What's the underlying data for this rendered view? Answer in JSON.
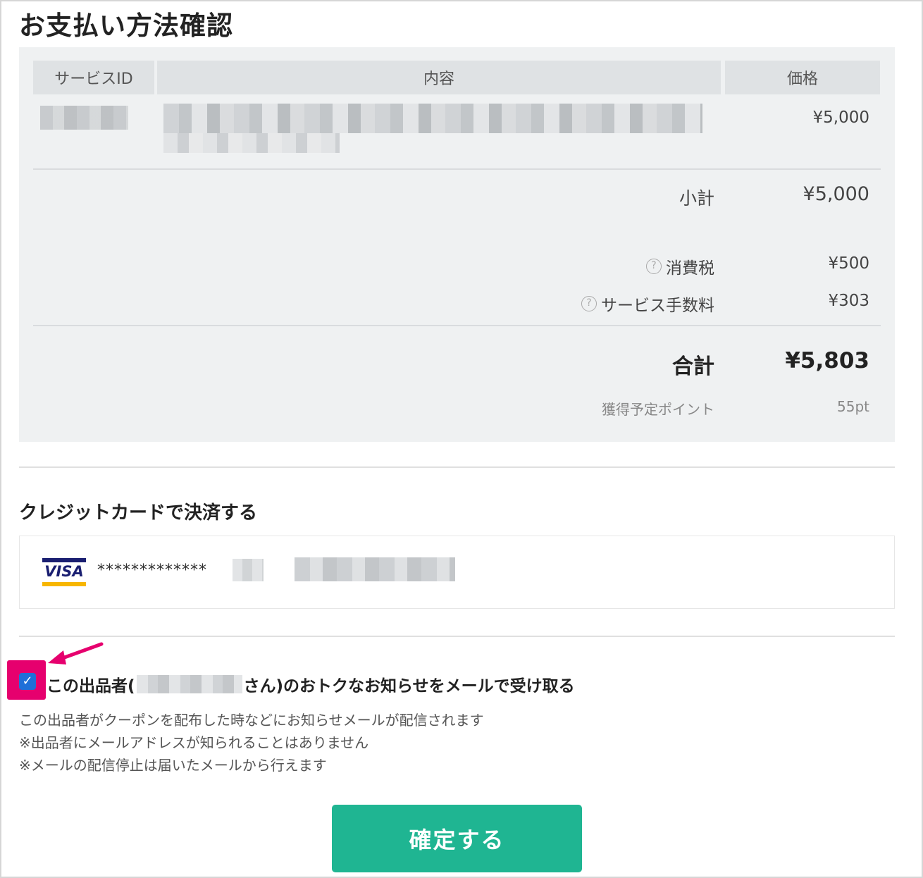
{
  "page": {
    "title": "お支払い方法確認"
  },
  "table": {
    "headers": {
      "service_id": "サービスID",
      "content": "内容",
      "price": "価格"
    },
    "rows": [
      {
        "price": "¥5,000"
      }
    ]
  },
  "summary": {
    "subtotal_label": "小計",
    "subtotal_value": "¥5,000",
    "tax_label": "消費税",
    "tax_value": "¥500",
    "fee_label": "サービス手数料",
    "fee_value": "¥303",
    "total_label": "合計",
    "total_value": "¥5,803",
    "points_label": "獲得予定ポイント",
    "points_value": "55pt",
    "help_icon_glyph": "?"
  },
  "payment": {
    "section_title": "クレジットカードで決済する",
    "card_brand": "VISA",
    "card_number_masked": "*************"
  },
  "optin": {
    "checked": true,
    "check_glyph": "✓",
    "label_prefix": "この出品者(",
    "label_suffix": "さん)のおトクなお知らせをメールで受け取る",
    "notes": [
      "この出品者がクーポンを配布した時などにお知らせメールが配信されます",
      "※出品者にメールアドレスが知られることはありません",
      "※メールの配信停止は届いたメールから行えます"
    ]
  },
  "actions": {
    "confirm_label": "確定する"
  },
  "colors": {
    "accent_button": "#1fb592",
    "highlight": "#e6006e",
    "checkbox": "#1f6fd8",
    "visa_blue": "#1a1f71",
    "visa_gold": "#f7b600"
  },
  "icons": {
    "help": "help-circle-icon",
    "arrow": "annotation-arrow-icon",
    "check": "checkmark-icon"
  }
}
